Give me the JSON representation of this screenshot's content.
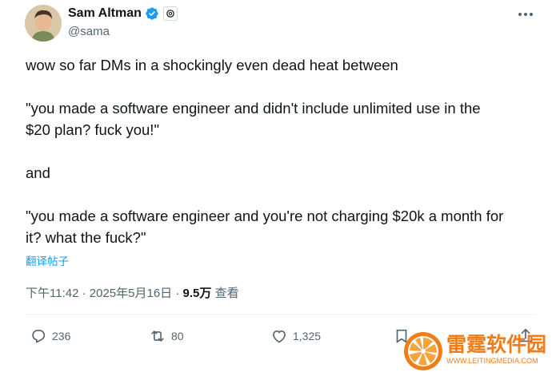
{
  "author": {
    "display_name": "Sam Altman",
    "handle": "@sama",
    "verified_icon": "verified-badge-icon",
    "affiliation_icon": "openai-logo-icon"
  },
  "tweet": {
    "lines": [
      "wow so far DMs in a shockingly even dead heat between",
      "\"you made a software engineer and didn't include unlimited use in the",
      "$20 plan? fuck you!\"",
      "and",
      "\"you made a software engineer and you're not charging $20k a month for",
      "it? what the fuck?\""
    ],
    "translate_label": "翻译帖子"
  },
  "meta": {
    "time": "下午11:42",
    "separator": "·",
    "date": "2025年5月16日",
    "views_count": "9.5万",
    "views_label": "查看"
  },
  "actions": {
    "replies": "236",
    "reposts": "80",
    "likes": "1,325"
  },
  "watermark": {
    "name": "雷霆软件园",
    "url": "WWW.LEITINGMEDIA.COM"
  },
  "colors": {
    "link": "#1d9bf0",
    "secondary_text": "#536471",
    "primary_text": "#0f1419",
    "watermark": "#f07d1a"
  }
}
